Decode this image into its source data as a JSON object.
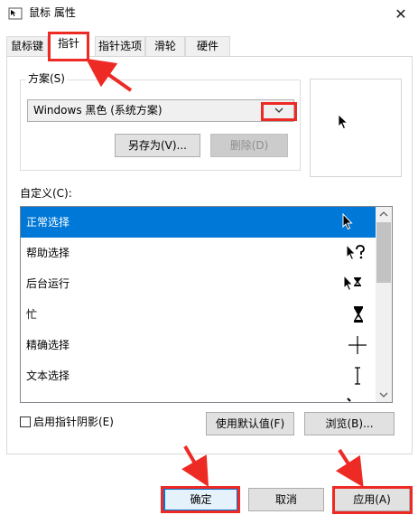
{
  "window": {
    "title": "鼠标 属性",
    "close_glyph": "✕"
  },
  "tabs": [
    {
      "label": "鼠标键",
      "active": false
    },
    {
      "label": "指针",
      "active": true
    },
    {
      "label": "指针选项",
      "active": false
    },
    {
      "label": "滑轮",
      "active": false
    },
    {
      "label": "硬件",
      "active": false
    }
  ],
  "scheme": {
    "label": "方案(S)",
    "selected": "Windows 黑色 (系统方案)",
    "save_as_label": "另存为(V)...",
    "delete_label": "删除(D)"
  },
  "customize": {
    "label": "自定义(C):",
    "items": [
      {
        "label": "正常选择",
        "icon": "arrow-cursor-icon",
        "selected": true
      },
      {
        "label": "帮助选择",
        "icon": "help-cursor-icon",
        "selected": false
      },
      {
        "label": "后台运行",
        "icon": "working-in-background-cursor-icon",
        "selected": false
      },
      {
        "label": "忙",
        "icon": "busy-hourglass-cursor-icon",
        "selected": false
      },
      {
        "label": "精确选择",
        "icon": "crosshair-cursor-icon",
        "selected": false
      },
      {
        "label": "文本选择",
        "icon": "text-ibeam-cursor-icon",
        "selected": false
      }
    ]
  },
  "shadow": {
    "label": "启用指针阴影(E)",
    "checked": false
  },
  "buttons": {
    "use_default": "使用默认值(F)",
    "browse": "浏览(B)...",
    "ok": "确定",
    "cancel": "取消",
    "apply": "应用(A)"
  },
  "colors": {
    "selection": "#0078d7",
    "annotation": "#ee2a24"
  }
}
